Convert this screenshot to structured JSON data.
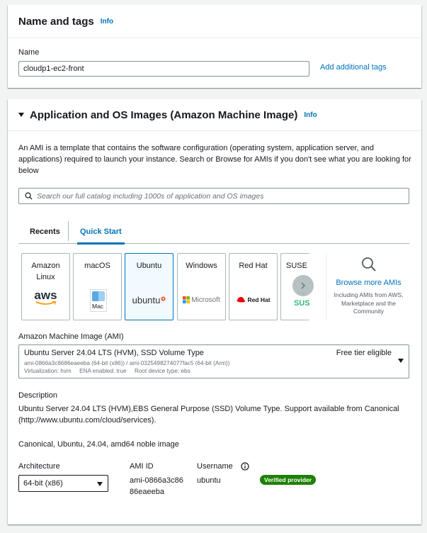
{
  "name_tags": {
    "title": "Name and tags",
    "info": "Info",
    "name_label": "Name",
    "name_value": "cloudp1-ec2-front",
    "add_tags": "Add additional tags"
  },
  "ami_section": {
    "title": "Application and OS Images (Amazon Machine Image)",
    "info": "Info",
    "intro": "An AMI is a template that contains the software configuration (operating system, application server, and applications) required to launch your instance. Search or Browse for AMIs if you don't see what you are looking for below",
    "search_placeholder": "Search our full catalog including 1000s of application and OS images",
    "tabs": [
      {
        "label": "Recents"
      },
      {
        "label": "Quick Start"
      }
    ],
    "cards": [
      {
        "title": "Amazon Linux",
        "logo": "aws"
      },
      {
        "title": "macOS",
        "logo": "Mac"
      },
      {
        "title": "Ubuntu",
        "logo": "ubuntu"
      },
      {
        "title": "Windows",
        "logo": "Microsoft"
      },
      {
        "title": "Red Hat",
        "logo": "Red Hat"
      },
      {
        "title": "SUSE Linux",
        "logo": "SUS"
      }
    ],
    "browse": {
      "title": "Browse more AMIs",
      "sub": "Including AMIs from AWS, Marketplace and the Community"
    },
    "ami_label": "Amazon Machine Image (AMI)",
    "ami": {
      "name": "Ubuntu Server 24.04 LTS (HVM), SSD Volume Type",
      "tier": "Free tier eligible",
      "ids": "ami-0866a3c8686eaeeba (64-bit (x86)) / ami-0325498274077fac5 (64-bit (Arm))",
      "meta": "Virtualization: hvm     ENA enabled: true     Root device type: ebs"
    },
    "description_label": "Description",
    "description": "Ubuntu Server 24.04 LTS (HVM),EBS General Purpose (SSD) Volume Type. Support available from Canonical (http://www.ubuntu.com/cloud/services).",
    "image_name": "Canonical, Ubuntu, 24.04, amd64 noble image",
    "architecture_label": "Architecture",
    "architecture_value": "64-bit (x86)",
    "ami_id_label": "AMI ID",
    "ami_id_line1": "ami-0866a3c86",
    "ami_id_line2": "86eaeeba",
    "username_label": "Username",
    "username_value": "ubuntu",
    "verified": "Verified provider"
  },
  "colors": {
    "link": "#0073bb",
    "selected_bg": "#f1faff",
    "verified": "#1d8102",
    "aws_orange": "#ff9900",
    "ubuntu_orange": "#e95420",
    "redhat": "#ee0000",
    "suse_green": "#30ba78"
  }
}
